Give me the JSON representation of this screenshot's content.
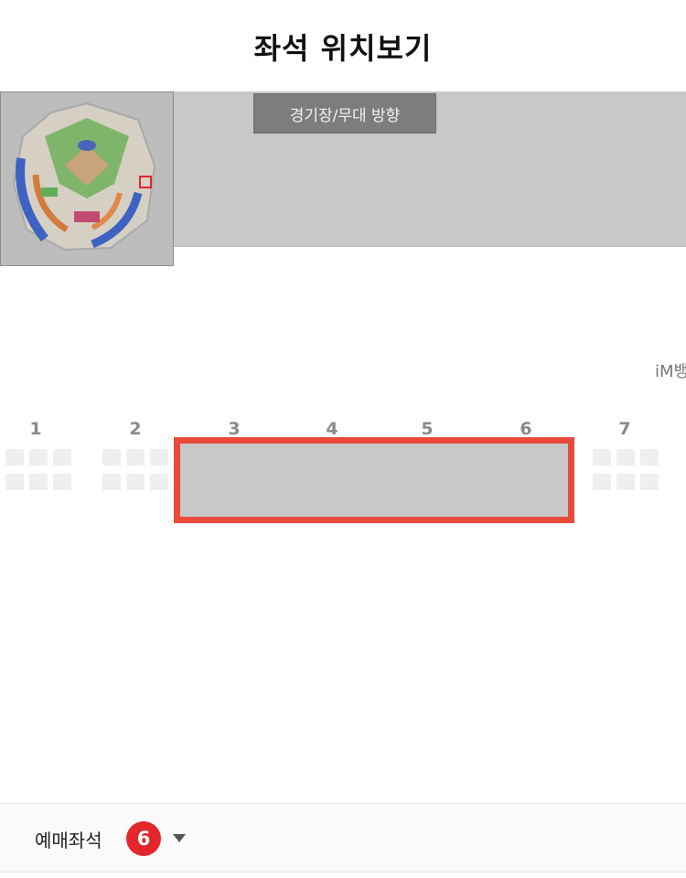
{
  "header": {
    "title": "좌석 위치보기"
  },
  "map": {
    "direction_label": "경기장/무대 방향",
    "side_label": "iM뱅"
  },
  "blocks": [
    "1",
    "2",
    "3",
    "4",
    "5",
    "6",
    "7"
  ],
  "selection": {
    "label": "예매좌석",
    "count": "6"
  },
  "colors": {
    "accent_red": "#e84a3c",
    "badge_red": "#e2262a",
    "panel_gray": "#c8c8c8"
  },
  "icons": {
    "dropdown": "chevron-down-icon"
  }
}
